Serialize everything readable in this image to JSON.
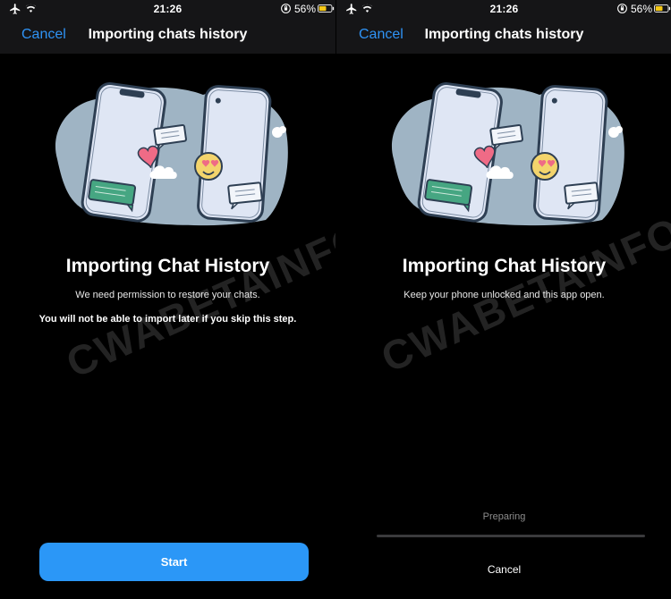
{
  "left": {
    "status": {
      "time": "21:26",
      "battery": "56%"
    },
    "nav": {
      "cancel": "Cancel",
      "title": "Importing chats history"
    },
    "heading": "Importing Chat History",
    "body_line1": "We need permission to restore your chats.",
    "body_line2": "You will not be able to import later if you skip this step.",
    "watermark": "CWABETAINFO",
    "start_label": "Start"
  },
  "right": {
    "status": {
      "time": "21:26",
      "battery": "56%"
    },
    "nav": {
      "cancel": "Cancel",
      "title": "Importing chats history"
    },
    "heading": "Importing Chat History",
    "body_line1": "Keep your phone unlocked and this app open.",
    "watermark": "CWABETAINFO",
    "preparing": "Preparing",
    "progress_fraction": 0,
    "cancel_label": "Cancel"
  },
  "colors": {
    "accent": "#2b97f7",
    "link": "#2f93f5",
    "blob": "#9fb4c4",
    "phone_screen": "#dfe6f4",
    "phone_frame": "#2e3f53",
    "heart": "#ef6b86",
    "green_bubble": "#46a682",
    "emoji": "#f3d46c"
  },
  "icons": [
    "airplane-icon",
    "wifi-icon",
    "orientation-lock-icon",
    "battery-icon"
  ]
}
